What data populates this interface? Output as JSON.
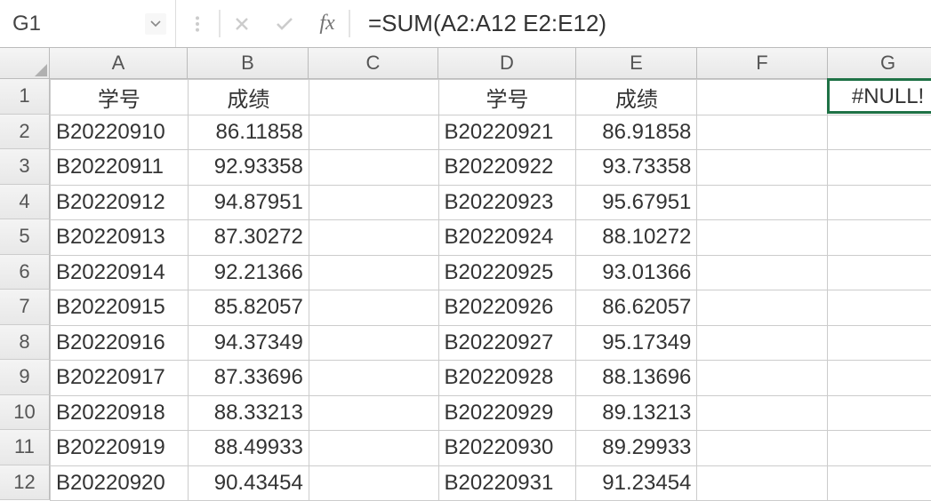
{
  "formula_bar": {
    "name_box": "G1",
    "fx_label": "fx",
    "formula": "=SUM(A2:A12 E2:E12)"
  },
  "columns": [
    {
      "key": "A",
      "width": 155
    },
    {
      "key": "B",
      "width": 136
    },
    {
      "key": "C",
      "width": 146
    },
    {
      "key": "D",
      "width": 155
    },
    {
      "key": "E",
      "width": 136
    },
    {
      "key": "F",
      "width": 147
    },
    {
      "key": "G",
      "width": 136
    }
  ],
  "row_numbers": [
    1,
    2,
    3,
    4,
    5,
    6,
    7,
    8,
    9,
    10,
    11,
    12
  ],
  "headers": {
    "A": "学号",
    "B": "成绩",
    "D": "学号",
    "E": "成绩"
  },
  "selected_cell": {
    "col": "G",
    "row": 1,
    "value": "#NULL!"
  },
  "rows": [
    {
      "A": "B20220910",
      "B": "86.11858",
      "D": "B20220921",
      "E": "86.91858"
    },
    {
      "A": "B20220911",
      "B": "92.93358",
      "D": "B20220922",
      "E": "93.73358"
    },
    {
      "A": "B20220912",
      "B": "94.87951",
      "D": "B20220923",
      "E": "95.67951"
    },
    {
      "A": "B20220913",
      "B": "87.30272",
      "D": "B20220924",
      "E": "88.10272"
    },
    {
      "A": "B20220914",
      "B": "92.21366",
      "D": "B20220925",
      "E": "93.01366"
    },
    {
      "A": "B20220915",
      "B": "85.82057",
      "D": "B20220926",
      "E": "86.62057"
    },
    {
      "A": "B20220916",
      "B": "94.37349",
      "D": "B20220927",
      "E": "95.17349"
    },
    {
      "A": "B20220917",
      "B": "87.33696",
      "D": "B20220928",
      "E": "88.13696"
    },
    {
      "A": "B20220918",
      "B": "88.33213",
      "D": "B20220929",
      "E": "89.13213"
    },
    {
      "A": "B20220919",
      "B": "88.49933",
      "D": "B20220930",
      "E": "89.29933"
    },
    {
      "A": "B20220920",
      "B": "90.43454",
      "D": "B20220931",
      "E": "91.23454"
    }
  ]
}
